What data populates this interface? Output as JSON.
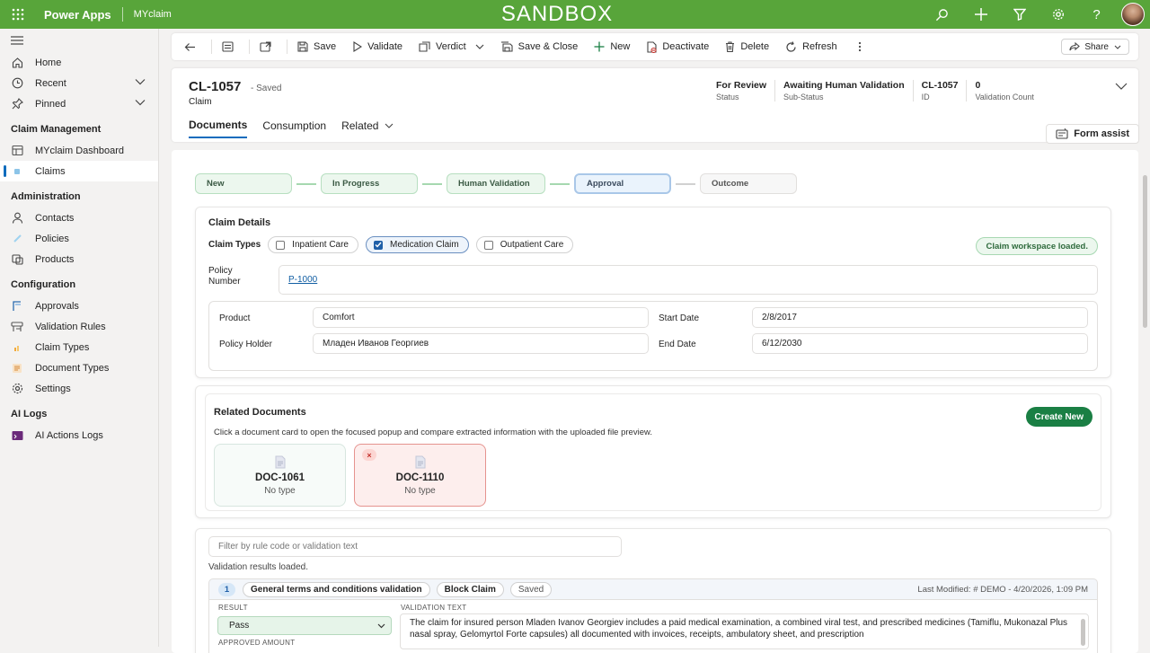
{
  "topbar": {
    "app_name": "Power Apps",
    "env_name": "MYclaim",
    "banner": "SANDBOX",
    "bg_color": "#58a53a"
  },
  "sidebar": {
    "items": [
      {
        "label": "Home",
        "icon": "home-icon"
      },
      {
        "label": "Recent",
        "icon": "clock-icon"
      },
      {
        "label": "Pinned",
        "icon": "pin-icon"
      }
    ],
    "sections": [
      {
        "title": "Claim Management",
        "items": [
          {
            "label": "MYclaim Dashboard"
          },
          {
            "label": "Claims"
          }
        ]
      },
      {
        "title": "Administration",
        "items": [
          {
            "label": "Contacts"
          },
          {
            "label": "Policies"
          },
          {
            "label": "Products"
          }
        ]
      },
      {
        "title": "Configuration",
        "items": [
          {
            "label": "Approvals"
          },
          {
            "label": "Validation Rules"
          },
          {
            "label": "Claim Types"
          },
          {
            "label": "Document Types"
          },
          {
            "label": "Settings"
          }
        ]
      },
      {
        "title": "AI Logs",
        "items": [
          {
            "label": "AI Actions Logs"
          }
        ]
      }
    ]
  },
  "commandbar": {
    "save": "Save",
    "validate": "Validate",
    "verdict": "Verdict",
    "save_close": "Save & Close",
    "new": "New",
    "deactivate": "Deactivate",
    "delete": "Delete",
    "refresh": "Refresh",
    "share": "Share"
  },
  "record": {
    "title": "CL-1057",
    "saved": "- Saved",
    "entity": "Claim",
    "fields": [
      {
        "value": "For Review",
        "label": "Status"
      },
      {
        "value": "Awaiting Human Validation",
        "label": "Sub-Status"
      },
      {
        "value": "CL-1057",
        "label": "ID"
      },
      {
        "value": "0",
        "label": "Validation Count"
      }
    ],
    "tabs": [
      "Documents",
      "Consumption",
      "Related"
    ],
    "form_assist": "Form assist"
  },
  "stages": [
    {
      "label": "New",
      "state": "done"
    },
    {
      "label": "In Progress",
      "state": "done"
    },
    {
      "label": "Human Validation",
      "state": "done"
    },
    {
      "label": "Approval",
      "state": "current"
    },
    {
      "label": "Outcome",
      "state": "future"
    }
  ],
  "claim_details": {
    "title": "Claim Details",
    "claim_types_label": "Claim Types",
    "claim_types": [
      {
        "label": "Inpatient Care",
        "checked": false
      },
      {
        "label": "Medication Claim",
        "checked": true
      },
      {
        "label": "Outpatient Care",
        "checked": false
      }
    ],
    "toast": "Claim workspace loaded.",
    "policy_number_label": "Policy Number",
    "policy_number": "P-1000",
    "product_label": "Product",
    "product": "Comfort",
    "start_date_label": "Start Date",
    "start_date": "2/8/2017",
    "policy_holder_label": "Policy Holder",
    "policy_holder": "Младен Иванов Георгиев",
    "end_date_label": "End Date",
    "end_date": "6/12/2030"
  },
  "related_documents": {
    "title": "Related Documents",
    "hint": "Click a document card to open the focused popup and compare extracted information with the uploaded file preview.",
    "create_new": "Create New",
    "docs": [
      {
        "name": "DOC-1061",
        "type": "No type",
        "error": false
      },
      {
        "name": "DOC-1110",
        "type": "No type",
        "error": true
      }
    ]
  },
  "validation": {
    "filter_placeholder": "Filter by rule code or validation text",
    "status": "Validation results loaded.",
    "row": {
      "number": "1",
      "rule": "General terms and conditions validation",
      "severity": "Block Claim",
      "state": "Saved",
      "last_modified": "Last Modified: # DEMO - 4/20/2026, 1:09 PM",
      "result_label": "RESULT",
      "result": "Pass",
      "text_label": "VALIDATION TEXT",
      "text": "The claim for insured person Mladen Ivanov Georgiev includes a paid medical examination, a combined viral test, and prescribed medicines (Tamiflu, Mukonazal Plus nasal spray, Gelomyrtol Forte capsules) all documented with invoices, receipts, ambulatory sheet, and prescription",
      "approved_label": "APPROVED AMOUNT"
    }
  }
}
